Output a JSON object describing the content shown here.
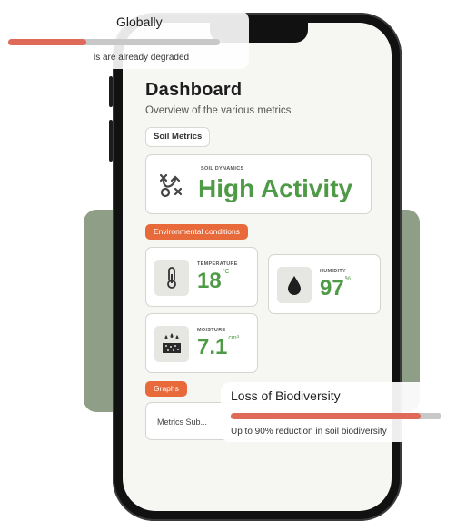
{
  "colors": {
    "accent_green": "#4f9a46",
    "accent_orange": "#e8693a",
    "progress_fill": "#e06a5a",
    "backdrop": "#8f9f87"
  },
  "overlay_top": {
    "title": "Globally",
    "subtitle": "ls are already degraded",
    "progress_fraction": 0.37
  },
  "dashboard": {
    "title": "Dashboard",
    "subtitle": "Overview of the various metrics",
    "soil_metrics_chip": "Soil Metrics",
    "soil_dynamics": {
      "label": "SOIL DYNAMICS",
      "value": "High Activity",
      "icon": "shuffle-icon"
    },
    "environmental_label": "Environmental conditions",
    "temperature": {
      "label": "TEMPERATURE",
      "value": "18",
      "unit": "°C",
      "icon": "thermometer-icon"
    },
    "humidity": {
      "label": "HUMIDITY",
      "value": "97",
      "unit": "%",
      "icon": "water-drop-icon"
    },
    "moisture": {
      "label": "MOISTURE",
      "value": "7.1",
      "unit": "cm³",
      "icon": "soil-moisture-icon"
    },
    "graphs_label": "Graphs",
    "graphs_card_text": "Metrics Sub..."
  },
  "overlay_bottom": {
    "title": "Loss of Biodiversity",
    "subtitle": "Up to 90% reduction in soil biodiversity",
    "progress_fraction": 0.9
  }
}
